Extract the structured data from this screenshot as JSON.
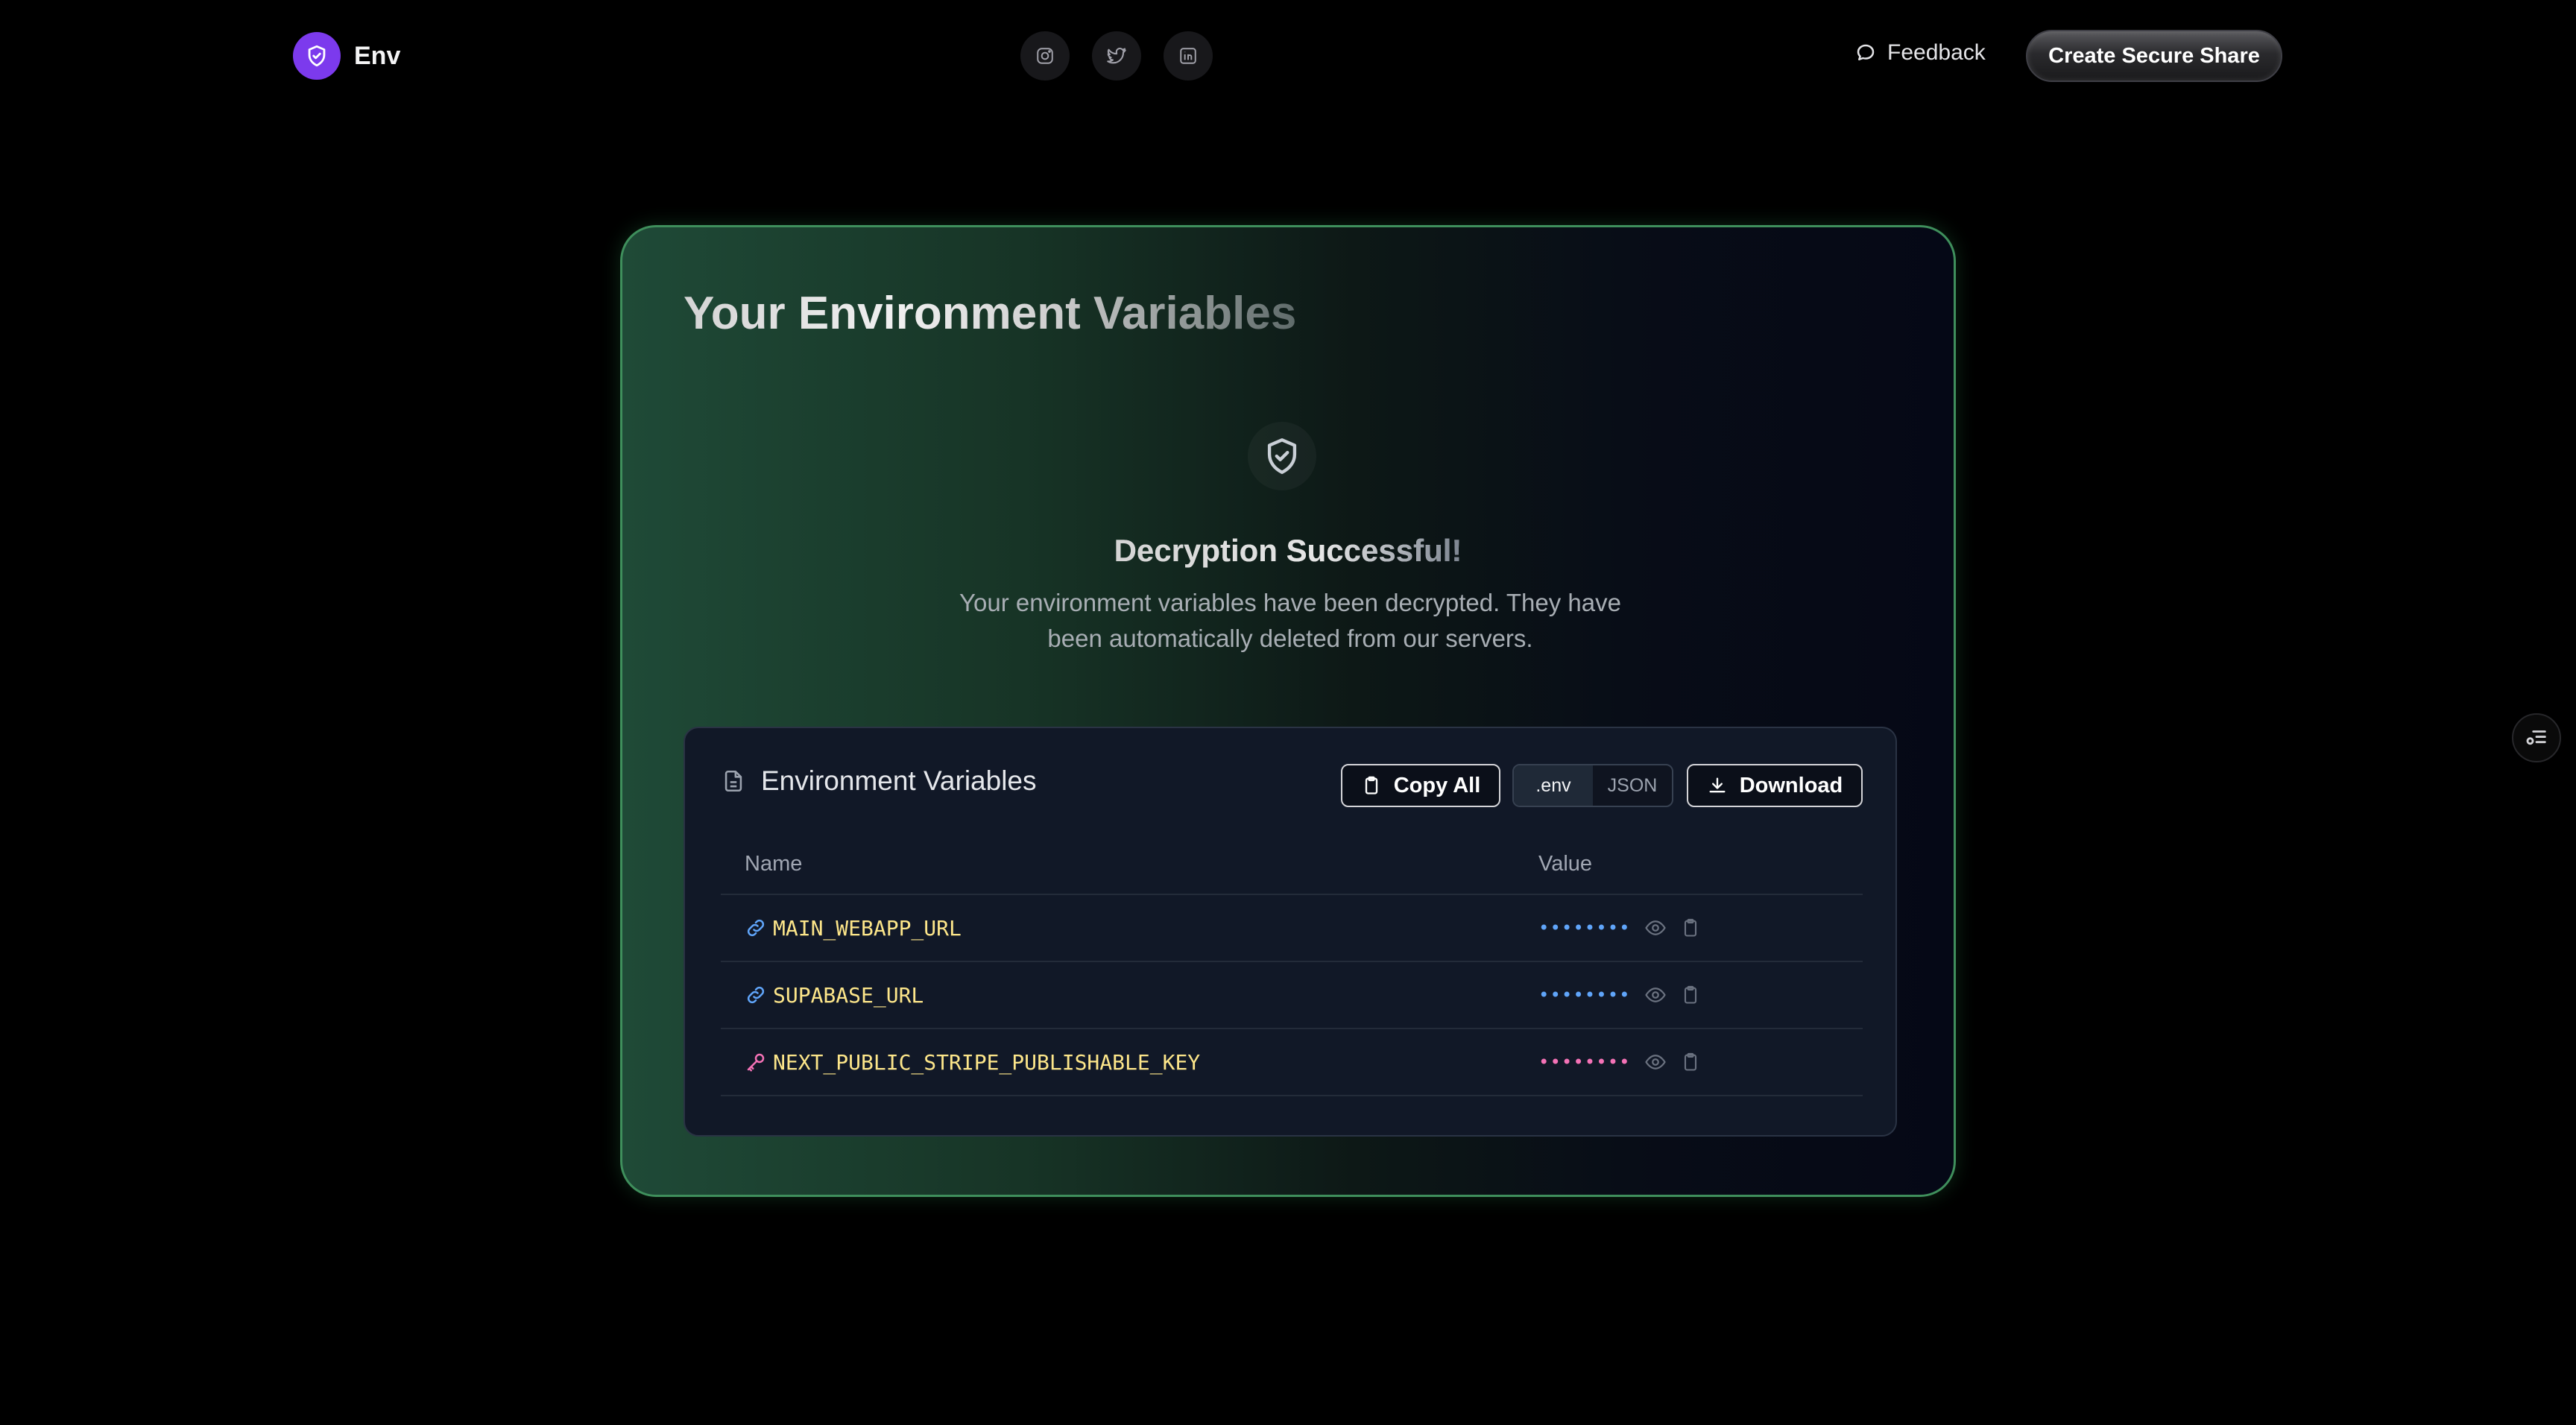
{
  "header": {
    "brand_name": "Env",
    "feedback_label": "Feedback",
    "create_label": "Create Secure Share",
    "socials": [
      "instagram-icon",
      "twitter-icon",
      "linkedin-icon"
    ]
  },
  "card": {
    "title": "Your Environment Variables",
    "success_title": "Decryption Successful!",
    "success_desc": "Your environment variables have been decrypted. They have been automatically deleted from our servers."
  },
  "panel": {
    "title": "Environment Variables",
    "copy_all_label": "Copy All",
    "format_options": [
      ".env",
      "JSON"
    ],
    "format_selected": ".env",
    "download_label": "Download",
    "columns": [
      "Name",
      "Value"
    ],
    "rows": [
      {
        "name": "MAIN_WEBAPP_URL",
        "icon": "link-icon",
        "masked": "••••••••",
        "mask_color": "#60a5fa"
      },
      {
        "name": "SUPABASE_URL",
        "icon": "link-icon",
        "masked": "••••••••",
        "mask_color": "#60a5fa"
      },
      {
        "name": "NEXT_PUBLIC_STRIPE_PUBLISHABLE_KEY",
        "icon": "key-icon",
        "masked": "••••••••",
        "mask_color": "#f472b6"
      }
    ]
  },
  "colors": {
    "brand_accent": "#7c3aed",
    "card_border": "#3f8f5c",
    "var_name": "#fde68a",
    "mask_blue": "#60a5fa",
    "mask_pink": "#f472b6"
  }
}
